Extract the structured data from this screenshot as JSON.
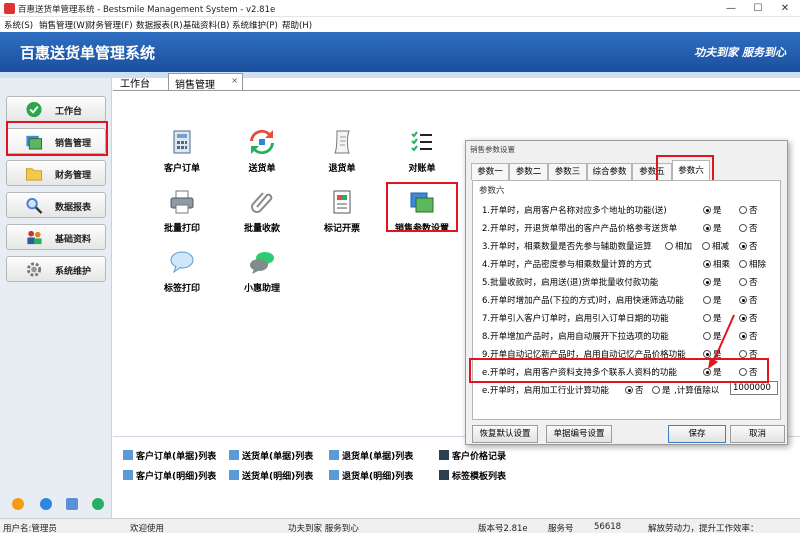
{
  "window": {
    "title": "百惠送货单管理系统 - Bestsmile Management System - v2.81e",
    "controls": [
      "—",
      "☐",
      "✕"
    ]
  },
  "menu": [
    "系统(S)",
    "销售管理(W)",
    "财务管理(F)",
    "数据报表(R)",
    "基础资料(B)",
    "系统维护(P)",
    "帮助(H)"
  ],
  "banner": {
    "title": "百惠送货单管理系统",
    "slogan": "功夫到家 服务到心"
  },
  "sidebar": {
    "items": [
      {
        "label": "工作台",
        "icon": "check-circle-icon",
        "color": "#2ea44f"
      },
      {
        "label": "销售管理",
        "icon": "window-icon",
        "color": "#3a8ad8"
      },
      {
        "label": "财务管理",
        "icon": "folder-icon",
        "color": "#f2c94c"
      },
      {
        "label": "数据报表",
        "icon": "magnifier-icon",
        "color": "#4a7fd0"
      },
      {
        "label": "基础资料",
        "icon": "people-icon",
        "color": "#c0392b"
      },
      {
        "label": "系统维护",
        "icon": "gear-icon",
        "color": "#777777"
      }
    ],
    "active": "销售管理"
  },
  "tabs": {
    "workbench": "工作台",
    "sales": "销售管理",
    "close": "×"
  },
  "functions": [
    {
      "label": "客户订单",
      "icon": "calculator-icon"
    },
    {
      "label": "送货单",
      "icon": "sync-arrows-icon"
    },
    {
      "label": "退货单",
      "icon": "scroll-icon"
    },
    {
      "label": "对账单",
      "icon": "checklist-icon"
    },
    {
      "label": "批量打印",
      "icon": "printer-icon"
    },
    {
      "label": "批量收款",
      "icon": "paperclip-icon"
    },
    {
      "label": "标记开票",
      "icon": "document-icon"
    },
    {
      "label": "销售参数设置",
      "icon": "window-icon"
    },
    {
      "label": "标签打印",
      "icon": "speech-bubble-icon"
    },
    {
      "label": "小惠助理",
      "icon": "chat-bubbles-icon"
    }
  ],
  "bottom_links": [
    "客户订单(单据)列表",
    "送货单(单据)列表",
    "退货单(单据)列表",
    "客户价格记录",
    "客户订单(明细)列表",
    "送货单(明细)列表",
    "退货单(明细)列表",
    "标签模板列表"
  ],
  "status": {
    "user": "用户名:管理员",
    "welcome": "欢迎使用",
    "slogan": "功夫到家 服务到心",
    "version": "版本号2.81e",
    "service_label": "服务号",
    "service_no": "56618",
    "message": "解放劳动力，提升工作效率："
  },
  "dialog": {
    "title": "销售参数设置",
    "tabs": [
      "参数一",
      "参数二",
      "参数三",
      "综合参数",
      "参数五",
      "参数六"
    ],
    "active_tab": "参数六",
    "group": "参数六",
    "rows": [
      {
        "text": "1.开单时，启用客户名称对应多个地址的功能(送)",
        "options": [
          "是",
          "否"
        ],
        "selected": "是"
      },
      {
        "text": "2.开单时，开退货单带出的客户产品价格参考送货单",
        "options": [
          "是",
          "否"
        ],
        "selected": "是"
      },
      {
        "text": "3.开单时，相乘数量是否先参与辅助数量运算",
        "options": [
          "相加",
          "相减",
          "否"
        ],
        "selected": "否"
      },
      {
        "text": "4.开单时，产品密度参与相乘数量计算的方式",
        "options": [
          "相乘",
          "相除"
        ],
        "selected": "相乘"
      },
      {
        "text": "5.批量收款时，启用送(退)货单批量收付款功能",
        "options": [
          "是",
          "否"
        ],
        "selected": "是"
      },
      {
        "text": "6.开单时增加产品(下拉的方式)时，启用快速筛选功能",
        "options": [
          "是",
          "否"
        ],
        "selected": "否"
      },
      {
        "text": "7.开单引入客户订单时，启用引入订单日期的功能",
        "options": [
          "是",
          "否"
        ],
        "selected": "否"
      },
      {
        "text": "8.开单增加产品时，启用自动展开下拉选项的功能",
        "options": [
          "是",
          "否"
        ],
        "selected": "否"
      },
      {
        "text": "9.开单自动记忆新产品时，启用自动记忆产品价格功能",
        "options": [
          "是",
          "否"
        ],
        "selected": "是"
      },
      {
        "text": "e.开单时，启用客户资料支持多个联系人资料的功能",
        "options": [
          "是",
          "否"
        ],
        "selected": "是"
      }
    ],
    "last_row": {
      "text": "e.开单时，启用加工行业计算功能",
      "options": [
        "否",
        "是"
      ],
      "selected": "否",
      "calc_label": ",计算值除以",
      "calc_value": "1000000"
    },
    "buttons": {
      "restore": "恢复默认设置",
      "numbering": "单据编号设置",
      "save": "保存",
      "cancel": "取消"
    }
  },
  "highlight_color": "#e0151f"
}
